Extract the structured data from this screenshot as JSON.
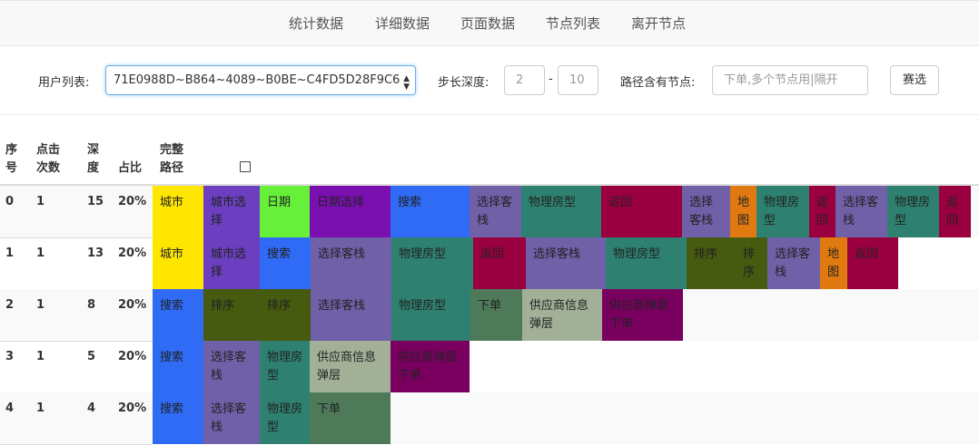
{
  "nav": {
    "items": [
      "统计数据",
      "详细数据",
      "页面数据",
      "节点列表",
      "离开节点"
    ]
  },
  "filter": {
    "user_label": "用户列表:",
    "user_value": "71E0988D~B864~4089~B0BE~C4FD5D28F9C6",
    "depth_label": "步长深度:",
    "depth_min": "2",
    "depth_sep": "-",
    "depth_max": "10",
    "path_label": "路径含有节点:",
    "path_placeholder": "下单,多个节点用|隔开",
    "filter_button": "赛选"
  },
  "table": {
    "headers": {
      "index": "序\n号",
      "clicks": "点击\n次数",
      "depth": "深\n度",
      "ratio": "占比",
      "path": "完整\n路径"
    },
    "rows": [
      {
        "index": "0",
        "clicks": "1",
        "depth": "15",
        "ratio": "20%",
        "path": [
          "城市",
          "城市选择",
          "日期",
          "日期选择",
          "搜索",
          "选择客栈",
          "物理房型",
          "返回",
          "选择客栈",
          "地图",
          "物理房型",
          "返回",
          "选择客栈",
          "物理房型",
          "返回"
        ]
      },
      {
        "index": "1",
        "clicks": "1",
        "depth": "13",
        "ratio": "20%",
        "path": [
          "城市",
          "城市选择",
          "搜索",
          "选择客栈",
          "物理房型",
          "返回",
          "选择客栈",
          "物理房型",
          "排序",
          "排序",
          "选择客栈",
          "地图",
          "返回"
        ]
      },
      {
        "index": "2",
        "clicks": "1",
        "depth": "8",
        "ratio": "20%",
        "path": [
          "搜索",
          "排序",
          "排序",
          "选择客栈",
          "物理房型",
          "下单",
          "供应商信息弹层",
          "供应商弹层下单"
        ]
      },
      {
        "index": "3",
        "clicks": "1",
        "depth": "5",
        "ratio": "20%",
        "path": [
          "搜索",
          "选择客栈",
          "物理房型",
          "供应商信息弹层",
          "供应商弹层下单"
        ]
      },
      {
        "index": "4",
        "clicks": "1",
        "depth": "4",
        "ratio": "20%",
        "path": [
          "搜索",
          "选择客栈",
          "物理房型",
          "下单"
        ]
      }
    ]
  },
  "node_colors": {
    "城市": "#FFE600",
    "城市选择": "#6B3FC0",
    "日期": "#66F03A",
    "日期选择": "#7A10B0",
    "搜索": "#2F6BF5",
    "选择客栈": "#7060A8",
    "物理房型": "#2E8070",
    "返回": "#9A0040",
    "地图": "#E07A10",
    "排序": "#465A10",
    "下单": "#4E7A5A",
    "供应商信息弹层": "#A2B098",
    "供应商弹层下单": "#7A0060"
  }
}
